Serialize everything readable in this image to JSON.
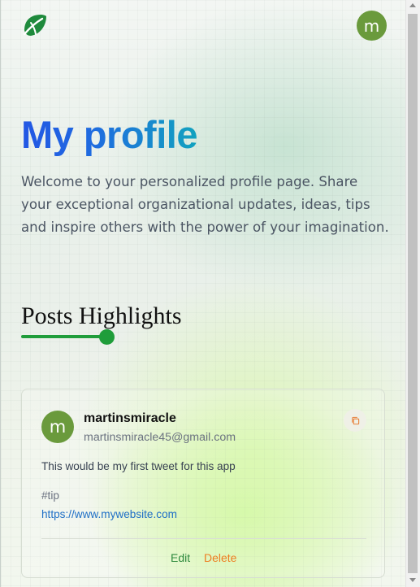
{
  "header": {
    "logo_icon": "leaf-logo-icon",
    "avatar_initial": "m"
  },
  "hero": {
    "title": "My profile",
    "description": "Welcome to your personalized profile page. Share your exceptional organizational updates, ideas, tips and inspire others with the power of your imagination."
  },
  "section": {
    "title": "Posts Highlights"
  },
  "post": {
    "avatar_initial": "m",
    "username": "martinsmiracle",
    "email": "martinsmiracle45@gmail.com",
    "copy_icon": "copy-icon",
    "text": "This would be my first tweet for this app",
    "tag": "#tip",
    "link": "https://www.mywebsite.com",
    "edit_label": "Edit",
    "delete_label": "Delete"
  },
  "colors": {
    "brand_green": "#1f9d3a",
    "avatar_green": "#6a9a3c",
    "title_gradient_start": "#2357e4",
    "title_gradient_end": "#12a2bf",
    "delete_orange": "#ee7d22",
    "link_blue": "#1f6fc6"
  }
}
